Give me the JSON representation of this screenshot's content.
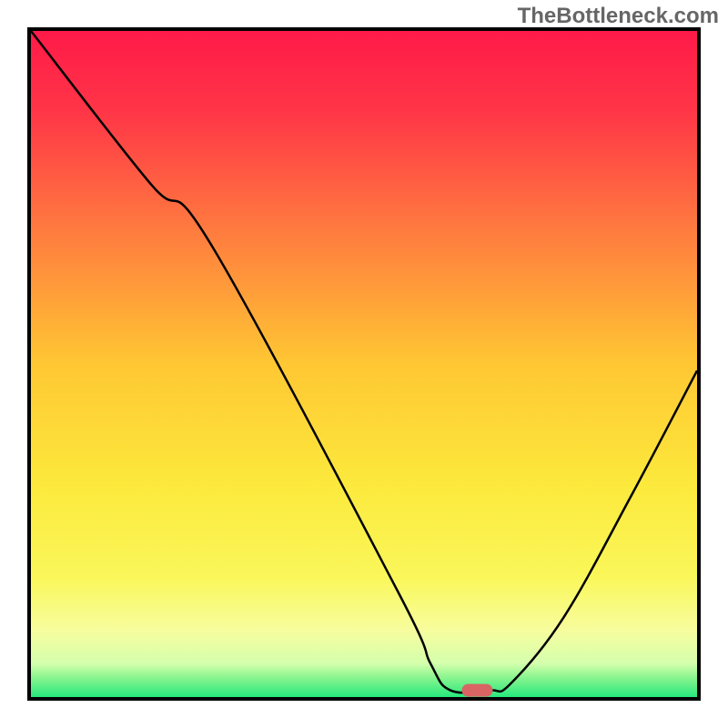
{
  "watermark": "TheBottleneck.com",
  "chart_data": {
    "type": "line",
    "title": "",
    "xlabel": "",
    "ylabel": "",
    "xlim": [
      0,
      100
    ],
    "ylim": [
      0,
      100
    ],
    "background_gradient": {
      "stops": [
        {
          "offset": 0.0,
          "color": "#ff1a49"
        },
        {
          "offset": 0.12,
          "color": "#ff3547"
        },
        {
          "offset": 0.3,
          "color": "#ff7b3f"
        },
        {
          "offset": 0.5,
          "color": "#ffc733"
        },
        {
          "offset": 0.68,
          "color": "#fce93c"
        },
        {
          "offset": 0.82,
          "color": "#faf75a"
        },
        {
          "offset": 0.9,
          "color": "#f7fd9e"
        },
        {
          "offset": 0.95,
          "color": "#d4ffad"
        },
        {
          "offset": 0.97,
          "color": "#8cf58f"
        },
        {
          "offset": 1.0,
          "color": "#27e87e"
        }
      ]
    },
    "series": [
      {
        "name": "bottleneck-curve",
        "points": [
          {
            "x": 0,
            "y": 100
          },
          {
            "x": 18,
            "y": 77
          },
          {
            "x": 27,
            "y": 68
          },
          {
            "x": 55,
            "y": 16
          },
          {
            "x": 60,
            "y": 5
          },
          {
            "x": 63,
            "y": 1
          },
          {
            "x": 69,
            "y": 1
          },
          {
            "x": 72,
            "y": 2
          },
          {
            "x": 80,
            "y": 12
          },
          {
            "x": 90,
            "y": 30
          },
          {
            "x": 100,
            "y": 49
          }
        ]
      }
    ],
    "marker": {
      "name": "optimal-marker",
      "x": 67,
      "y": 1,
      "color": "#d86464"
    }
  }
}
